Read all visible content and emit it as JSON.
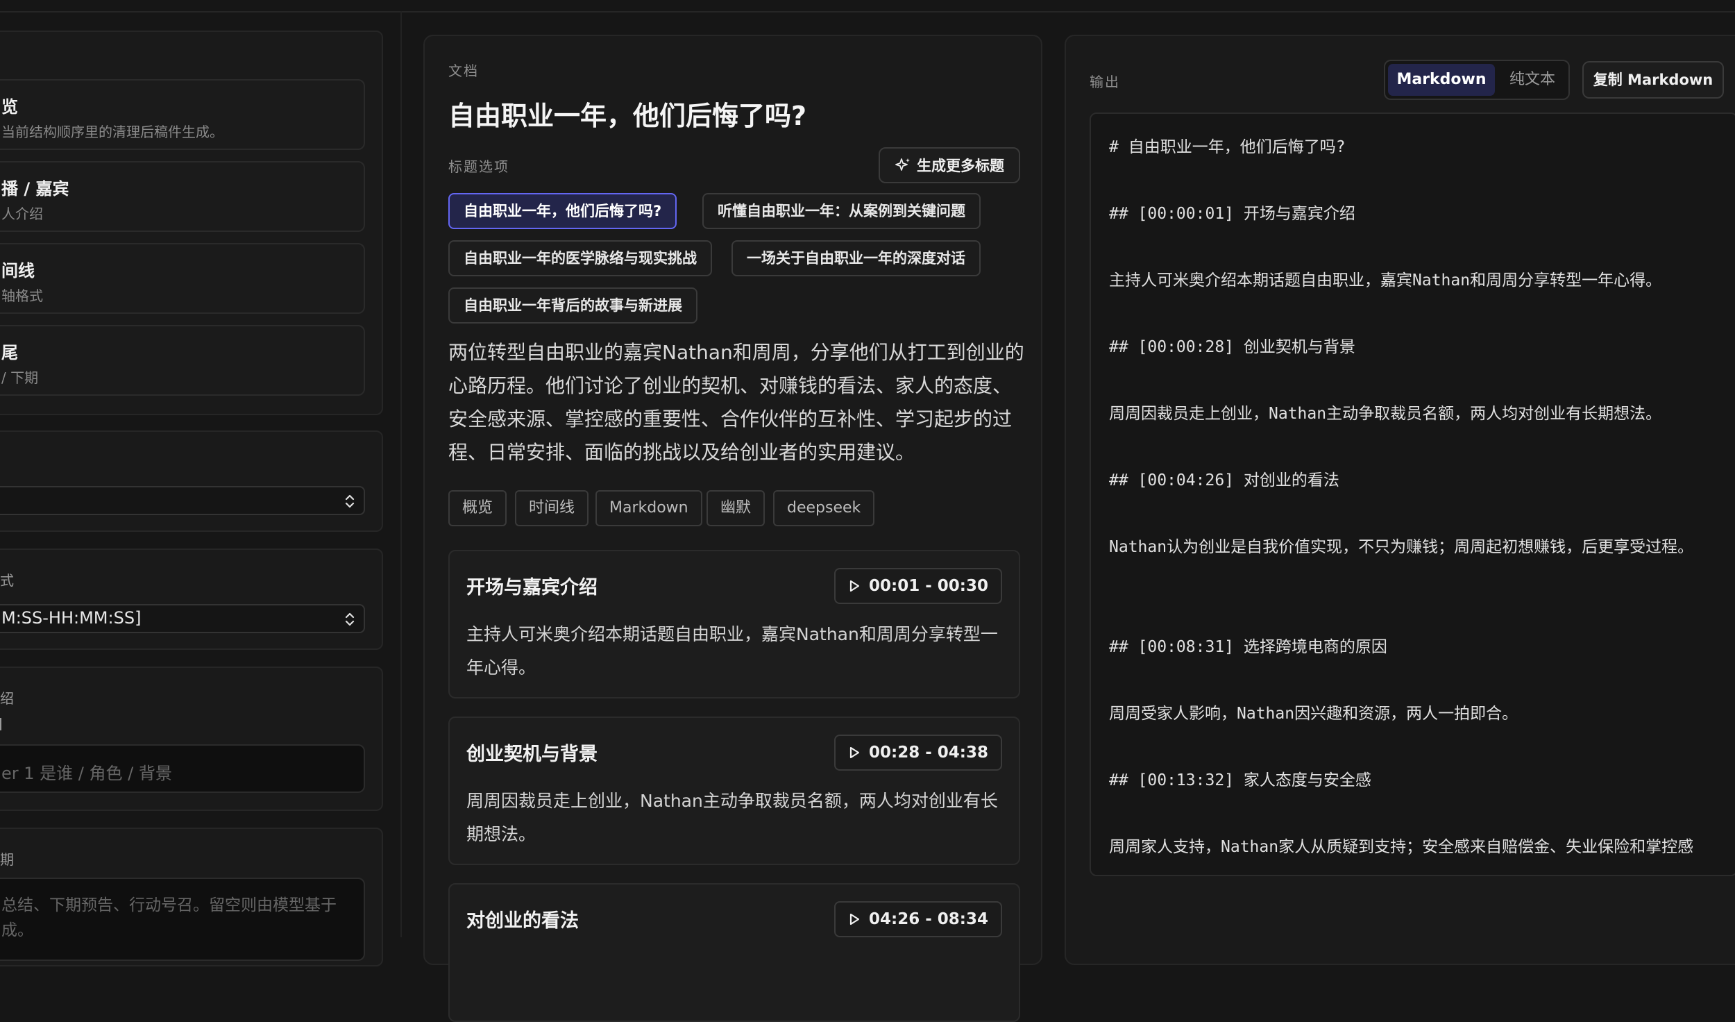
{
  "left": {
    "structure_items": [
      {
        "title": "览",
        "sub": "当前结构顺序里的清理后稿件生成。"
      },
      {
        "title": "播 / 嘉宾",
        "sub": "人介绍"
      },
      {
        "title": "间线",
        "sub": "轴格式"
      },
      {
        "title": "尾",
        "sub": "/ 下期"
      }
    ],
    "select_label_2": "式",
    "select_value_1": "",
    "select_value_2": "M:SS-HH:MM:SS]",
    "intro_label": "绍",
    "intro_sublabel": "",
    "intro_placeholder": "er 1 是谁 / 角色 / 背景",
    "outro_label": "期",
    "outro_placeholder": "总结、下期预告、行动号召。留空则由模型基于成。"
  },
  "doc": {
    "section_label": "文档",
    "title": "自由职业一年，他们后悔了吗?",
    "title_options_label": "标题选项",
    "generate_button": "生成更多标题",
    "title_options": [
      "自由职业一年，他们后悔了吗?",
      "听懂自由职业一年：从案例到关键问题",
      "自由职业一年的医学脉络与现实挑战",
      "一场关于自由职业一年的深度对话",
      "自由职业一年背后的故事与新进展"
    ],
    "summary": "两位转型自由职业的嘉宾Nathan和周周，分享他们从打工到创业的心路历程。他们讨论了创业的契机、对赚钱的看法、家人的态度、安全感来源、掌控感的重要性、合作伙伴的互补性、学习起步的过程、日常安排、面临的挑战以及给创业者的实用建议。",
    "tags": [
      "概览",
      "时间线",
      "Markdown",
      "幽默",
      "deepseek"
    ],
    "segments": [
      {
        "title": "开场与嘉宾介绍",
        "time": "00:01 - 00:30",
        "body": "主持人可米奥介绍本期话题自由职业，嘉宾Nathan和周周分享转型一年心得。"
      },
      {
        "title": "创业契机与背景",
        "time": "00:28 - 04:38",
        "body": "周周因裁员走上创业，Nathan主动争取裁员名额，两人均对创业有长期想法。"
      },
      {
        "title": "对创业的看法",
        "time": "04:26 - 08:34",
        "body": ""
      }
    ]
  },
  "output": {
    "label": "输出",
    "toggle_markdown": "Markdown",
    "toggle_plain": "纯文本",
    "copy_button": "复制 Markdown",
    "lines": [
      "# 自由职业一年，他们后悔了吗?",
      "## [00:00:01] 开场与嘉宾介绍",
      "主持人可米奥介绍本期话题自由职业，嘉宾Nathan和周周分享转型一年心得。",
      "## [00:00:28] 创业契机与背景",
      "周周因裁员走上创业，Nathan主动争取裁员名额，两人均对创业有长期想法。",
      "## [00:04:26] 对创业的看法",
      "Nathan认为创业是自我价值实现，不只为赚钱；周周起初想赚钱，后更享受过程。",
      "## [00:08:31] 选择跨境电商的原因",
      "周周受家人影响，Nathan因兴趣和资源，两人一拍即合。",
      "## [00:13:32] 家人态度与安全感",
      "周周家人支持，Nathan家人从质疑到支持；安全感来自赔偿金、失业保险和掌控感"
    ]
  }
}
